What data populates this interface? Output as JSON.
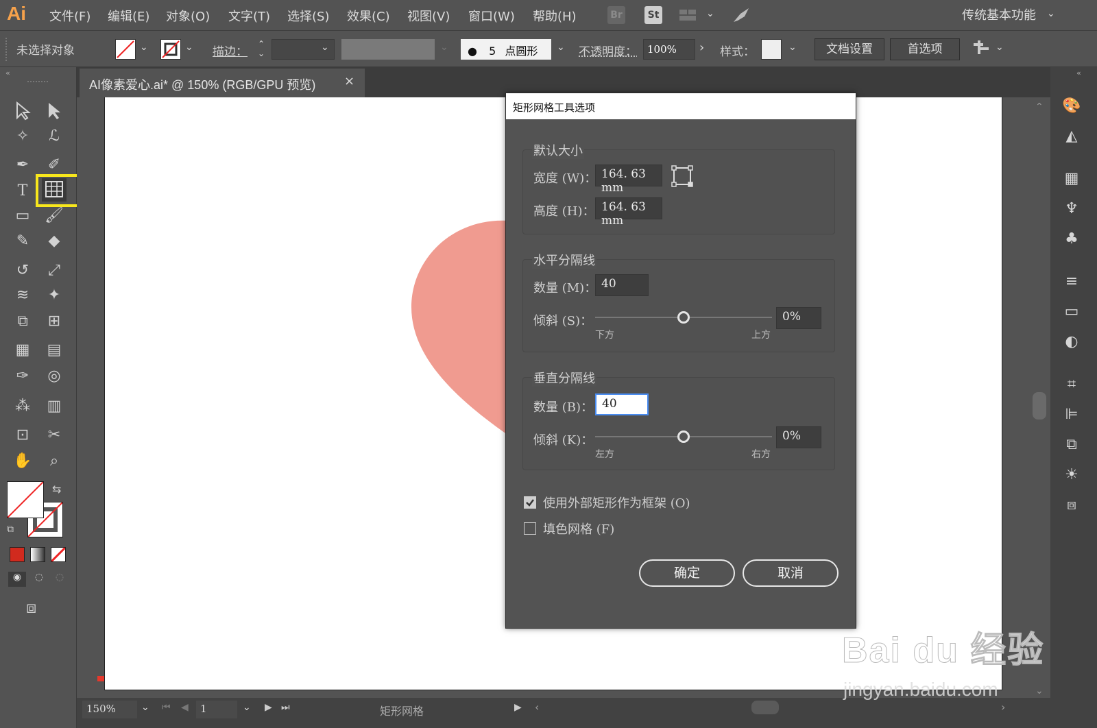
{
  "app": {
    "logo": "Ai"
  },
  "menu": [
    "文件(F)",
    "编辑(E)",
    "对象(O)",
    "文字(T)",
    "选择(S)",
    "效果(C)",
    "视图(V)",
    "窗口(W)",
    "帮助(H)"
  ],
  "menu_icons": {
    "bridge": "Br",
    "stock": "St"
  },
  "workspace": "传统基本功能",
  "control_bar": {
    "selection_status": "未选择对象",
    "stroke_label": "描边：",
    "brush_size": "5",
    "brush_label": "点圆形",
    "opacity_label": "不透明度：",
    "opacity_value": "100%",
    "style_label": "样式：",
    "doc_setup": "文档设置",
    "preferences": "首选项"
  },
  "document_tab": {
    "title": "AI像素爱心.ai* @ 150% (RGB/GPU 预览)",
    "close": "×"
  },
  "dialog": {
    "title": "矩形网格工具选项",
    "default_size": {
      "heading": "默认大小",
      "width_label": "宽度 (W)：",
      "width_value": "164. 63 mm",
      "height_label": "高度 (H)：",
      "height_value": "164. 63 mm"
    },
    "horizontal": {
      "heading": "水平分隔线",
      "count_label": "数量 (M)：",
      "count_value": "40",
      "skew_label": "倾斜 (S)：",
      "skew_value": "0%",
      "skew_position": 0.5,
      "left_caption": "下方",
      "right_caption": "上方"
    },
    "vertical": {
      "heading": "垂直分隔线",
      "count_label": "数量 (B)：",
      "count_value": "40",
      "skew_label": "倾斜 (K)：",
      "skew_value": "0%",
      "skew_position": 0.5,
      "left_caption": "左方",
      "right_caption": "右方"
    },
    "use_outer_rect": {
      "label": "使用外部矩形作为框架 (O)",
      "checked": true
    },
    "fill_grid": {
      "label": "填色网格 (F)",
      "checked": false
    },
    "ok": "确定",
    "cancel": "取消"
  },
  "status_bar": {
    "zoom": "150%",
    "artboard_number": "1",
    "tool_name": "矩形网格"
  },
  "colors": {
    "heart": "#f09b90",
    "highlight": "#f8e71c",
    "accent_field": "#4a8cf0"
  },
  "watermark": {
    "line1": "Bai du 经验",
    "line2": "jingyan.baidu.com"
  }
}
